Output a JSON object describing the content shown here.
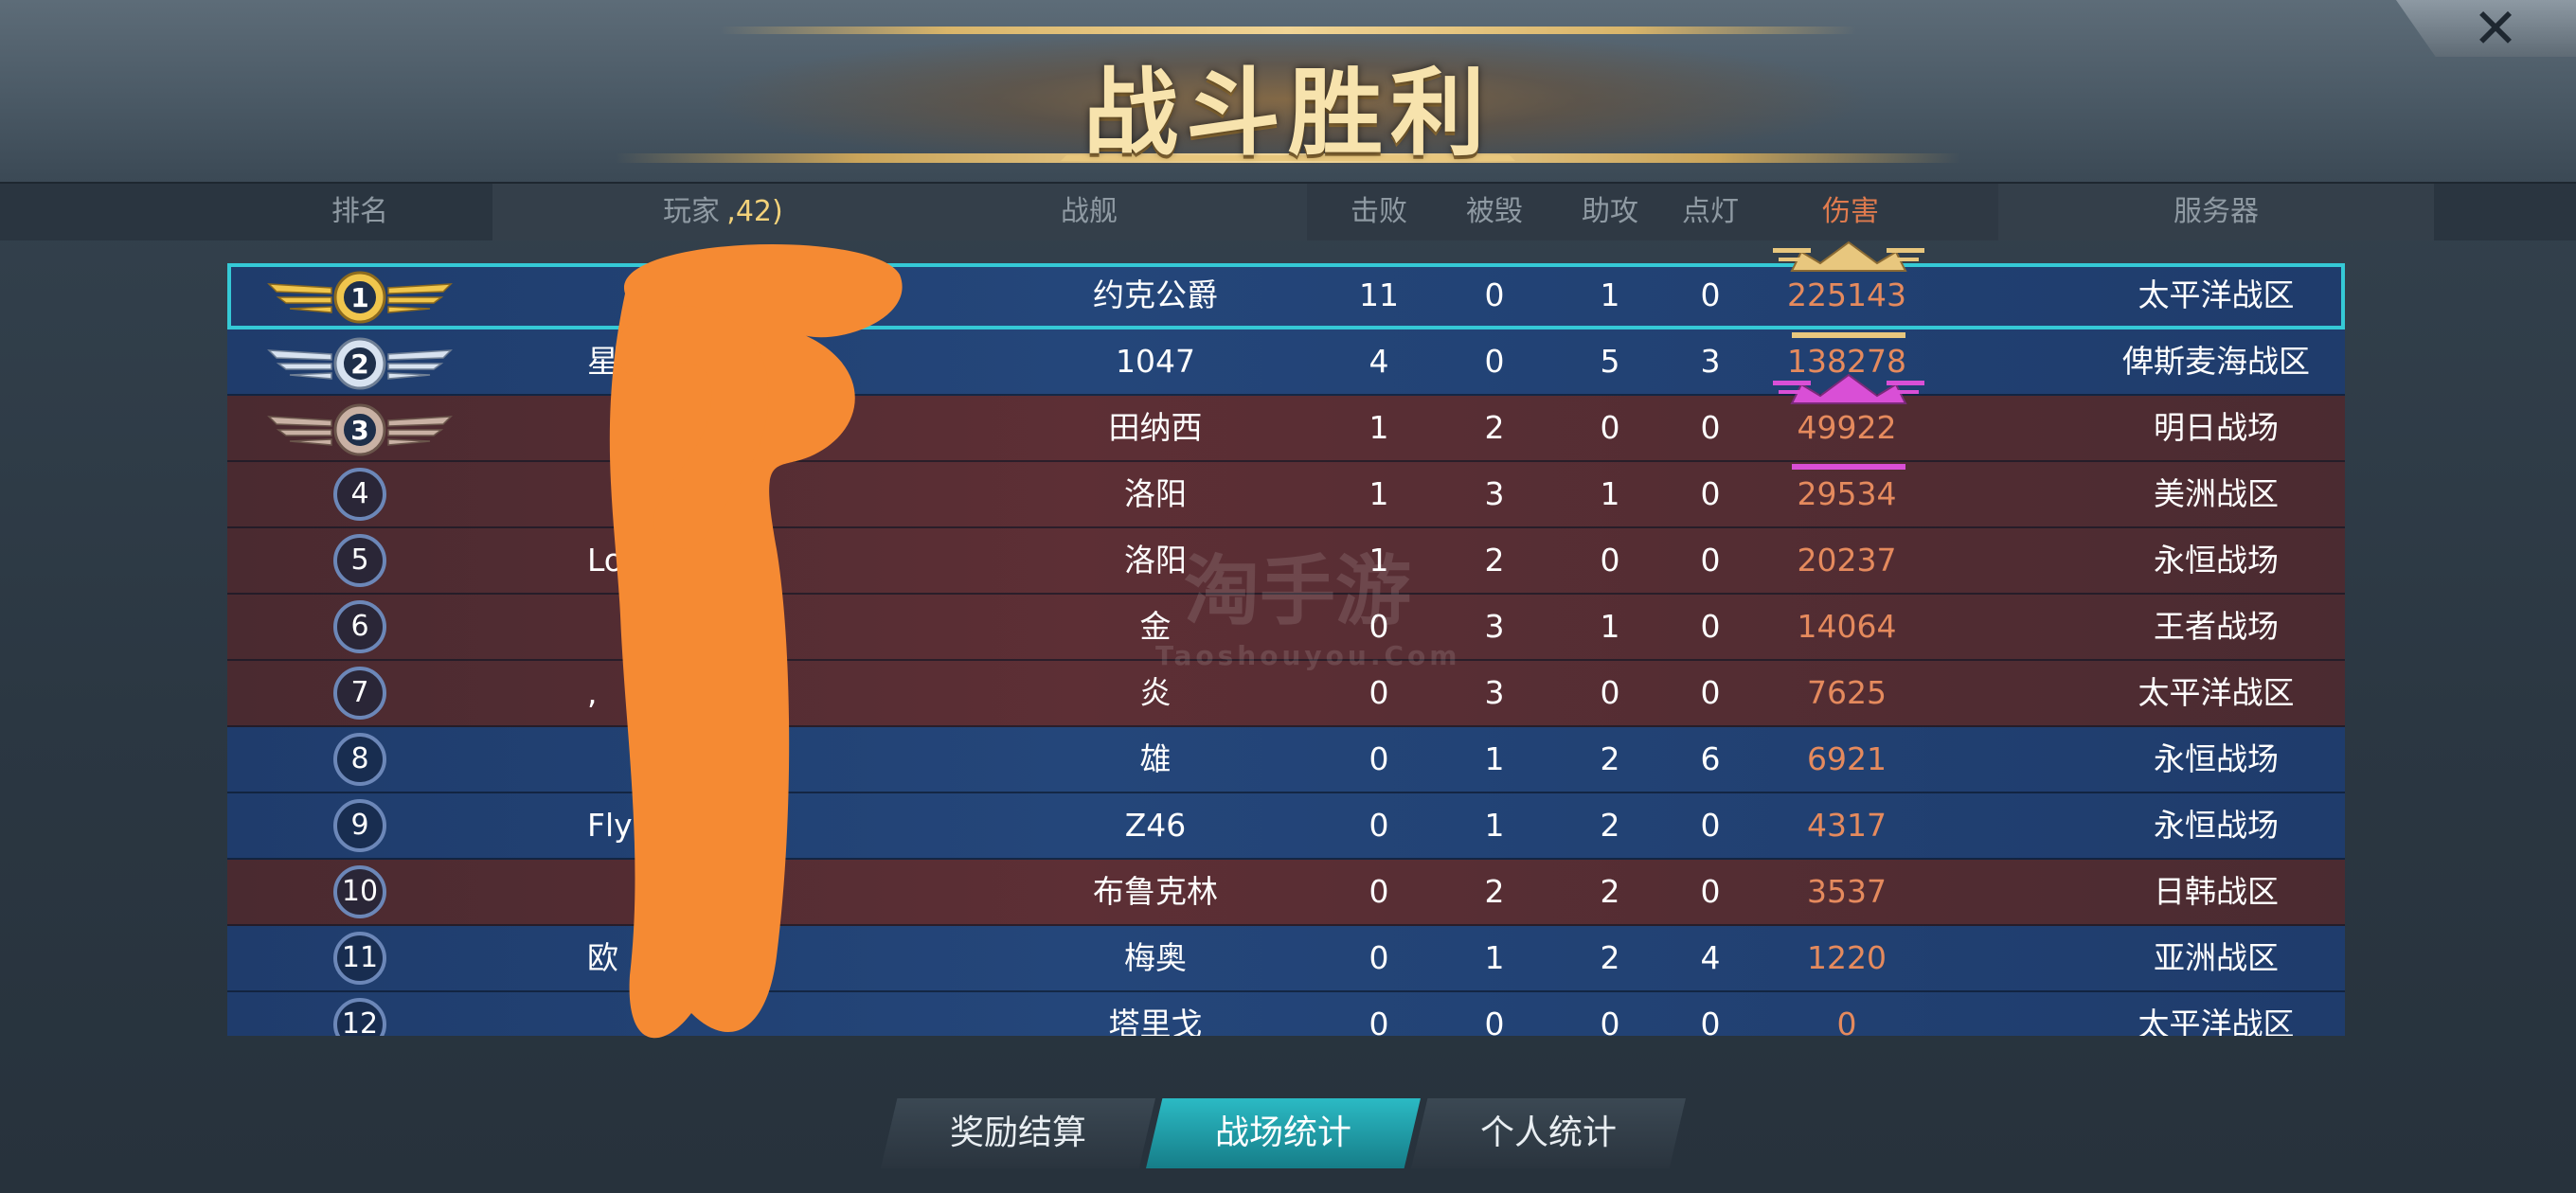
{
  "title": "战斗胜利",
  "columns": {
    "rank": "排名",
    "player": "玩家",
    "player_extra": ",42)",
    "ship": "战舰",
    "kills": "击败",
    "destroyed": "被毁",
    "assists": "助攻",
    "spots": "点灯",
    "damage": "伤害",
    "server": "服务器"
  },
  "rows": [
    {
      "rank": "1",
      "player": "",
      "ship": "约克公爵",
      "kills": "11",
      "destroyed": "0",
      "assists": "1",
      "spots": "0",
      "damage": "225143",
      "server": "太平洋战区"
    },
    {
      "rank": "2",
      "player": "星",
      "ship": "1047",
      "kills": "4",
      "destroyed": "0",
      "assists": "5",
      "spots": "3",
      "damage": "138278",
      "server": "俾斯麦海战区"
    },
    {
      "rank": "3",
      "player": "",
      "ship": "田纳西",
      "kills": "1",
      "destroyed": "2",
      "assists": "0",
      "spots": "0",
      "damage": "49922",
      "server": "明日战场"
    },
    {
      "rank": "4",
      "player": "",
      "ship": "洛阳",
      "kills": "1",
      "destroyed": "3",
      "assists": "1",
      "spots": "0",
      "damage": "29534",
      "server": "美洲战区"
    },
    {
      "rank": "5",
      "player": "Lor",
      "ship": "洛阳",
      "kills": "1",
      "destroyed": "2",
      "assists": "0",
      "spots": "0",
      "damage": "20237",
      "server": "永恒战场"
    },
    {
      "rank": "6",
      "player": "",
      "ship": "金",
      "kills": "0",
      "destroyed": "3",
      "assists": "1",
      "spots": "0",
      "damage": "14064",
      "server": "王者战场"
    },
    {
      "rank": "7",
      "player": ",",
      "ship": "炎",
      "kills": "0",
      "destroyed": "3",
      "assists": "0",
      "spots": "0",
      "damage": "7625",
      "server": "太平洋战区"
    },
    {
      "rank": "8",
      "player": "",
      "ship": "雄",
      "kills": "0",
      "destroyed": "1",
      "assists": "2",
      "spots": "6",
      "damage": "6921",
      "server": "永恒战场"
    },
    {
      "rank": "9",
      "player": "Fly",
      "ship": "Z46",
      "kills": "0",
      "destroyed": "1",
      "assists": "2",
      "spots": "0",
      "damage": "4317",
      "server": "永恒战场"
    },
    {
      "rank": "10",
      "player": "",
      "ship": "布鲁克林",
      "kills": "0",
      "destroyed": "2",
      "assists": "2",
      "spots": "0",
      "damage": "3537",
      "server": "日韩战区"
    },
    {
      "rank": "11",
      "player": "欧",
      "ship": "梅奥",
      "kills": "0",
      "destroyed": "1",
      "assists": "2",
      "spots": "4",
      "damage": "1220",
      "server": "亚洲战区"
    },
    {
      "rank": "12",
      "player": "",
      "ship": "塔里戈",
      "kills": "0",
      "destroyed": "0",
      "assists": "0",
      "spots": "0",
      "damage": "0",
      "server": "太平洋战区"
    }
  ],
  "row_colors": [
    "blue",
    "blue",
    "red",
    "red",
    "red",
    "red",
    "red",
    "blue",
    "blue",
    "red",
    "blue",
    "blue"
  ],
  "watermark": {
    "main": "淘手游",
    "sub": "Taoshouyou.Com"
  },
  "tabs": [
    {
      "label": "奖励结算",
      "active": false
    },
    {
      "label": "战场统计",
      "active": true
    },
    {
      "label": "个人统计",
      "active": false
    }
  ],
  "colors": {
    "accent": "#2bbac4",
    "gold": "#e8c77e",
    "damage": "#e58a5d",
    "blue_team": "#24467a",
    "red_team": "#5d2f35",
    "selected_outline": "#35c9d6",
    "scribble": "#f58a33"
  },
  "icons": {
    "close": "close-icon",
    "rank_1": "gold-wings-icon",
    "rank_2": "silver-wings-icon",
    "rank_3": "bronze-wings-icon",
    "mvp": "gold-crown-icon",
    "top_damage": "purple-crown-icon"
  }
}
